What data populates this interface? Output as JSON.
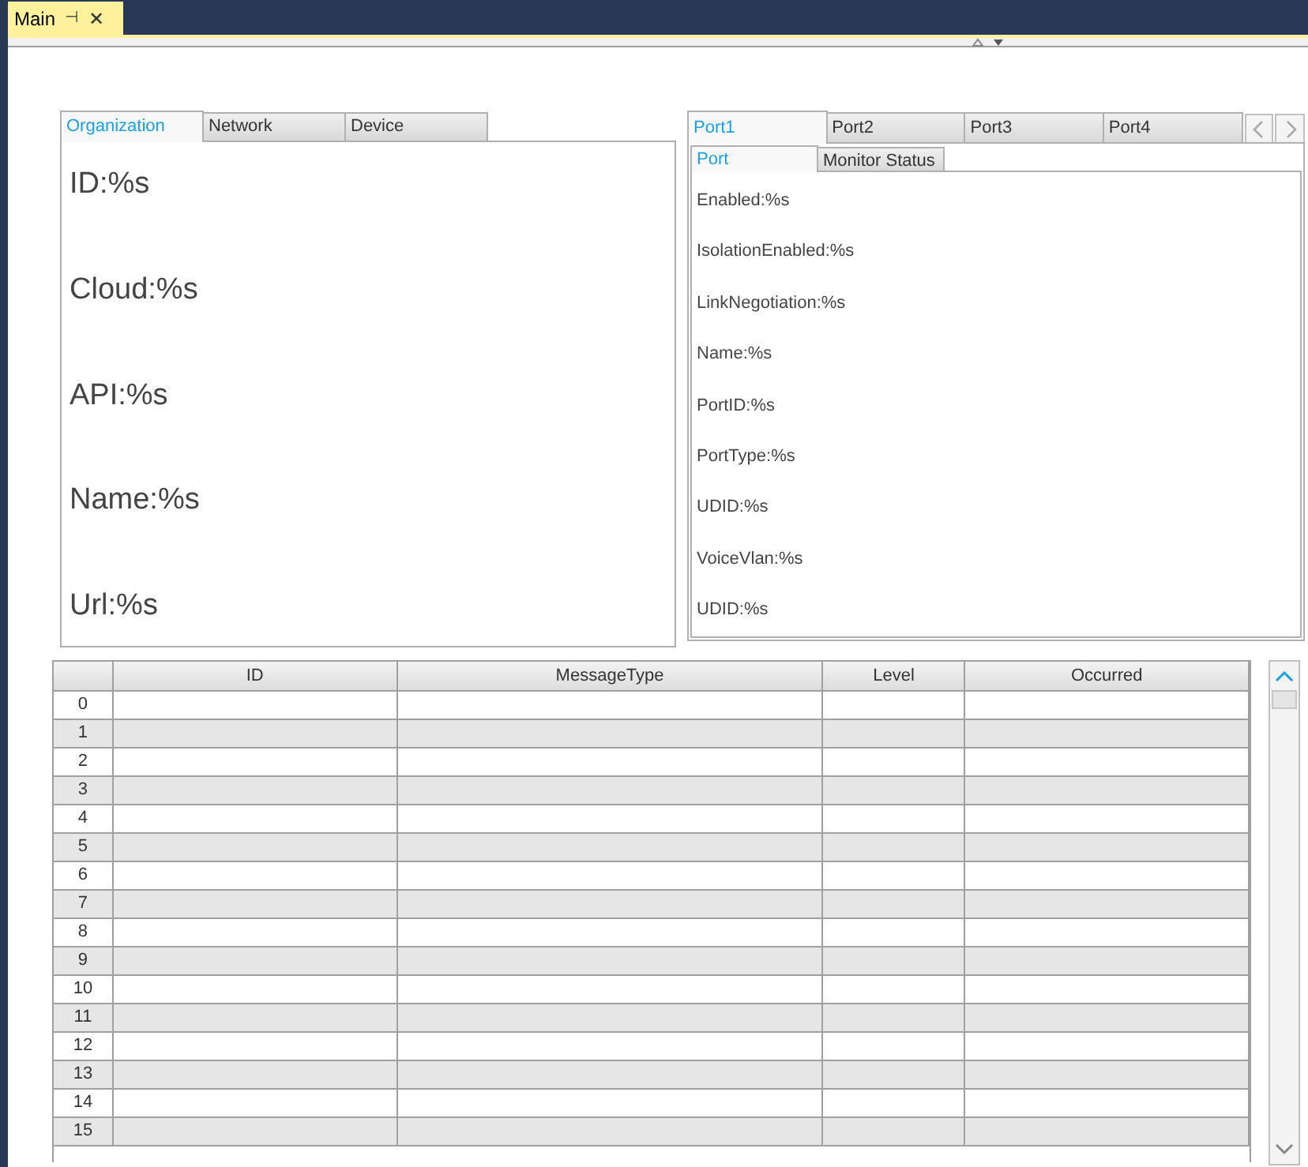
{
  "document_tab": {
    "title": "Main",
    "pin_glyph": "⊣",
    "close_glyph": "✕"
  },
  "left_tabs": [
    {
      "label": "Organization",
      "selected": true
    },
    {
      "label": "Network",
      "selected": false
    },
    {
      "label": "Device",
      "selected": false
    }
  ],
  "organization_fields": [
    "ID:%s",
    "Cloud:%s",
    "API:%s",
    "Name:%s",
    "Url:%s"
  ],
  "port_tabs": [
    {
      "label": "Port1",
      "selected": true
    },
    {
      "label": "Port2",
      "selected": false
    },
    {
      "label": "Port3",
      "selected": false
    },
    {
      "label": "Port4",
      "selected": false
    }
  ],
  "port_subtabs": [
    {
      "label": "Port",
      "selected": true
    },
    {
      "label": "Monitor Status",
      "selected": false
    }
  ],
  "port_fields": [
    "Enabled:%s",
    "IsolationEnabled:%s",
    "LinkNegotiation:%s",
    "Name:%s",
    "PortID:%s",
    "PortType:%s",
    "UDID:%s",
    "VoiceVlan:%s",
    "UDID:%s"
  ],
  "table": {
    "columns": [
      "ID",
      "MessageType",
      "Level",
      "Occurred"
    ],
    "rows": [
      "0",
      "1",
      "2",
      "3",
      "4",
      "5",
      "6",
      "7",
      "8",
      "9",
      "10",
      "11",
      "12",
      "13",
      "14",
      "15"
    ]
  }
}
